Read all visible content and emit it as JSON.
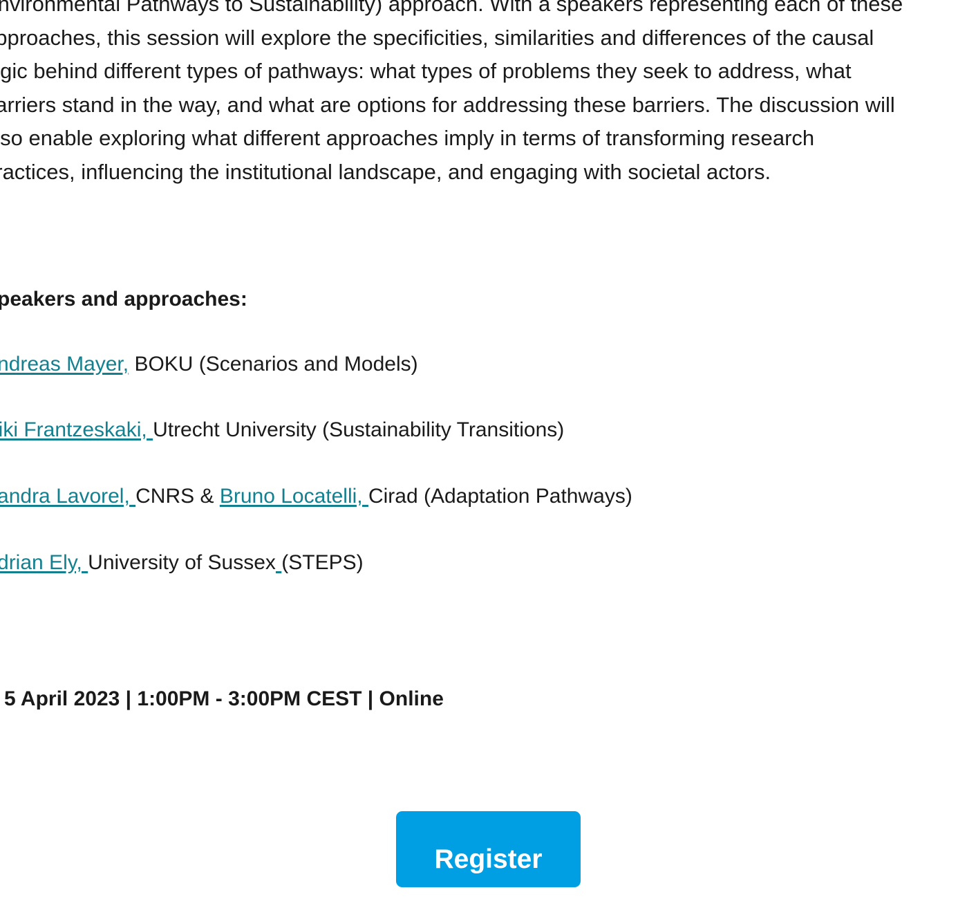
{
  "description": {
    "lines": [
      "Environmental Pathways to Sustainability) approach. With a speakers representing each of these",
      "approaches, this session will explore the specificities, similarities and differences of the causal",
      "logic behind different types of pathways: what types of problems they seek to address, what",
      "barriers stand in the way, and what are options for addressing these barriers. The discussion will",
      "also enable exploring what different approaches imply in terms of transforming research",
      "practices, influencing the institutional landscape, and engaging with societal actors."
    ]
  },
  "speakers_heading": "Speakers and approaches:",
  "speakers": [
    {
      "links": [
        {
          "text": "Andreas Mayer,"
        }
      ],
      "segments": [
        " BOKU (Scenarios and Models)"
      ]
    },
    {
      "links": [
        {
          "text": "Niki Frantzeskaki, "
        }
      ],
      "segments": [
        "Utrecht University (Sustainability Transitions)"
      ]
    },
    {
      "links": [
        {
          "text": "Sandra Lavorel, "
        },
        {
          "text": "Bruno Locatelli, "
        }
      ],
      "segments": [
        "CNRS & ",
        "Cirad (Adaptation Pathways)"
      ]
    },
    {
      "links": [
        {
          "text": "Adrian Ely, "
        },
        {
          "text": " "
        }
      ],
      "segments": [
        "University of Sussex",
        "(STEPS)"
      ]
    }
  ],
  "event_info": "5 April 2023 | 1:00PM - 3:00PM CEST | Online",
  "register_label": "Register",
  "colors": {
    "link": "#13808f",
    "button": "#009fe3",
    "text": "#1a1a1a"
  }
}
